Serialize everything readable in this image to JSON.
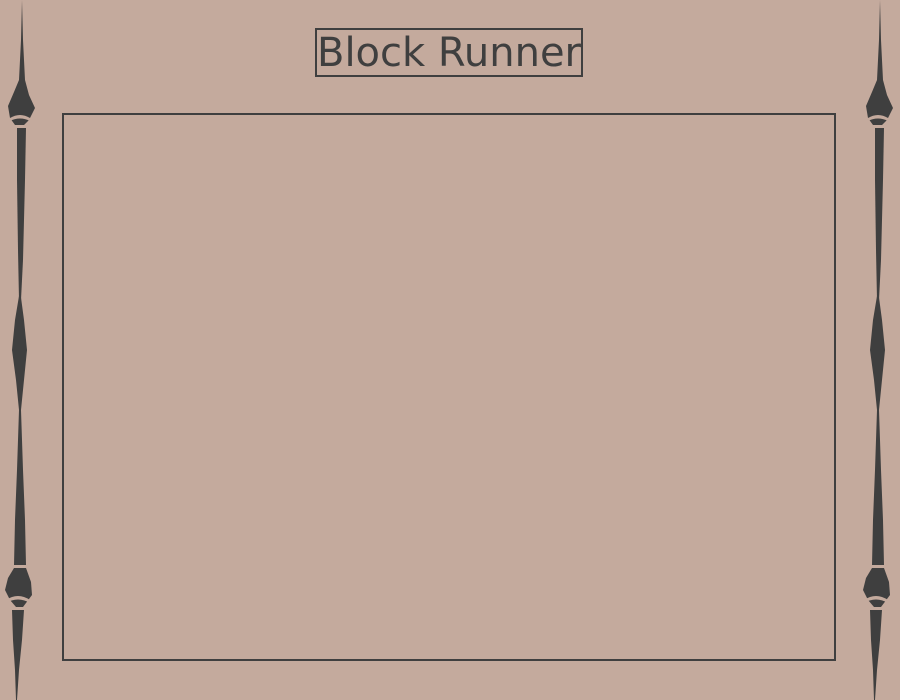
{
  "game": {
    "title": "Block Runner"
  },
  "decor": {
    "left_border": "ornament-spike",
    "right_border": "ornament-spike"
  },
  "colors": {
    "background": "#c4aa9d",
    "ink": "#3f3f3f"
  }
}
